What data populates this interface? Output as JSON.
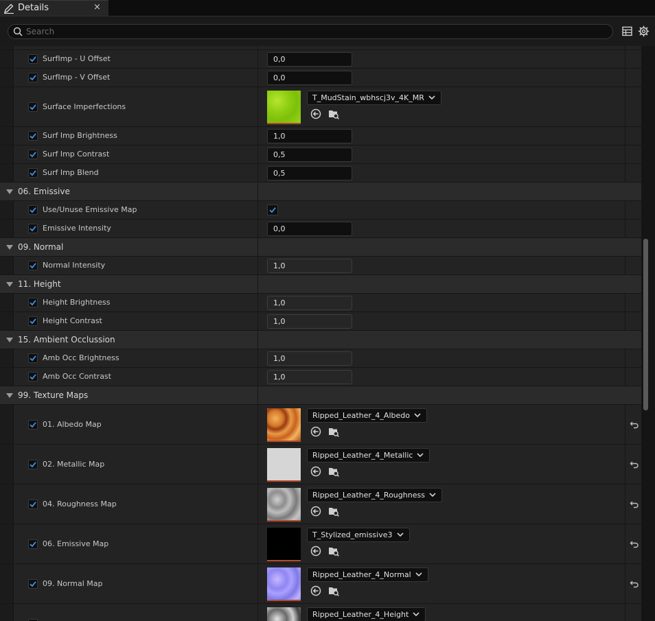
{
  "tab": {
    "title": "Details",
    "close": "×"
  },
  "search": {
    "placeholder": "Search"
  },
  "properties": {
    "surf_u_offset": {
      "label": "SurfImp - U Offset",
      "value": "0,0"
    },
    "surf_v_offset": {
      "label": "SurfImp - V Offset",
      "value": "0,0"
    },
    "surface_imperfections": {
      "label": "Surface Imperfections",
      "texture": "T_MudStain_wbhscj3v_4K_MR"
    },
    "surf_imp_brightness": {
      "label": "Surf Imp Brightness",
      "value": "1,0"
    },
    "surf_imp_contrast": {
      "label": "Surf Imp Contrast",
      "value": "0,5"
    },
    "surf_imp_blend": {
      "label": "Surf Imp Blend",
      "value": "0,5"
    },
    "cat_emissive": "06. Emissive",
    "use_emissive_map": {
      "label": "Use/Unuse Emissive Map",
      "checked": true
    },
    "emissive_intensity": {
      "label": "Emissive Intensity",
      "value": "0,0"
    },
    "cat_normal": "09. Normal",
    "normal_intensity": {
      "label": "Normal Intensity",
      "value": "1,0"
    },
    "cat_height": "11. Height",
    "height_brightness": {
      "label": "Height Brightness",
      "value": "1,0"
    },
    "height_contrast": {
      "label": "Height Contrast",
      "value": "1,0"
    },
    "cat_ao": "15. Ambient Occlussion",
    "amb_occ_brightness": {
      "label": "Amb Occ Brightness",
      "value": "1,0"
    },
    "amb_occ_contrast": {
      "label": "Amb Occ Contrast",
      "value": "1,0"
    },
    "cat_texture_maps": "99. Texture Maps",
    "albedo_map": {
      "label": "01. Albedo Map",
      "texture": "Ripped_Leather_4_Albedo"
    },
    "metallic_map": {
      "label": "02. Metallic Map",
      "texture": "Ripped_Leather_4_Metallic"
    },
    "roughness_map": {
      "label": "04. Roughness Map",
      "texture": "Ripped_Leather_4_Roughness"
    },
    "emissive_map": {
      "label": "06. Emissive Map",
      "texture": "T_Stylized_emissive3"
    },
    "normal_map": {
      "label": "09. Normal Map",
      "texture": "Ripped_Leather_4_Normal"
    },
    "height_map": {
      "label": "",
      "texture": "Ripped_Leather_4_Height"
    }
  },
  "colors": {
    "accent": "#3c8fe8",
    "panel": "#232323",
    "category": "#2b2b2b"
  }
}
